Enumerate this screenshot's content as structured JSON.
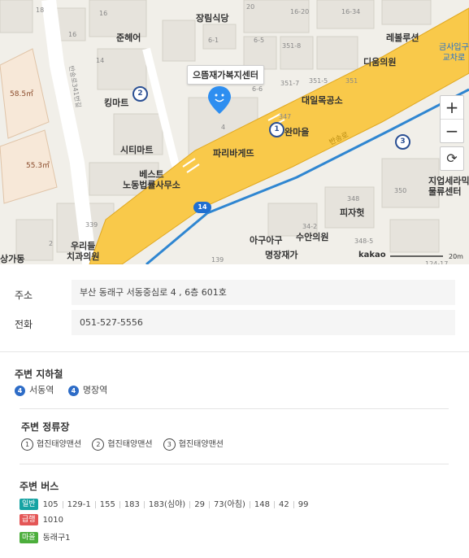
{
  "map": {
    "marker_label": "으뜸재가복지센터",
    "labels": {
      "jangrim": "장림식당",
      "junheo": "준헤어",
      "kingmart": "킹마트",
      "citymart": "시티마트",
      "best_law": "베스트\n노동법률사무소",
      "paris": "파리바게뜨",
      "daeil": "대일목공소",
      "maeul": "완마을",
      "rebeul": "레볼루션",
      "dium": "디움의원",
      "geumsa": "금사입구\n교차로",
      "jiup": "지업세라믹\n물류센터",
      "pizza": "피자헛",
      "agu": "아구아구",
      "suan": "수안의원",
      "myeongjang": "명장재가",
      "urideul": "우리들\n치과의원",
      "sang": "상가동",
      "road_name": "반송로",
      "side_road": "반송로341번길",
      "kakao": "kakao",
      "scale": "20m"
    },
    "numbers": [
      "18",
      "16",
      "20",
      "16-20",
      "16-34",
      "16",
      "6-1",
      "6-5",
      "351-8",
      "14",
      "351-7",
      "351-5",
      "351",
      "6-6",
      "4",
      "347",
      "350",
      "348",
      "339",
      "2",
      "34-2",
      "348-5",
      "139",
      "124-17"
    ],
    "areas": [
      "58.5㎡",
      "55.3㎡"
    ],
    "route_badge": "14",
    "stops": [
      "1",
      "2",
      "3"
    ],
    "controls": {
      "zoom_in": "+",
      "zoom_out": "−",
      "reset": "⟳"
    }
  },
  "address": {
    "label": "주소",
    "value": "부산 동래구 서동중심로 4 , 6층 601호"
  },
  "phone": {
    "label": "전화",
    "value": "051-527-5556"
  },
  "subway": {
    "title": "주변 지하철",
    "stations": [
      {
        "line": "4",
        "name": "서동역"
      },
      {
        "line": "4",
        "name": "명장역"
      }
    ]
  },
  "bus_stops": {
    "title": "주변 정류장",
    "items": [
      {
        "num": "1",
        "name": "협진태양맨션"
      },
      {
        "num": "2",
        "name": "협진태양맨션"
      },
      {
        "num": "3",
        "name": "협진태양맨션"
      }
    ]
  },
  "buses": {
    "title": "주변 버스",
    "groups": [
      {
        "tag": "일반",
        "color": "#16a3a3",
        "numbers": [
          "105",
          "129-1",
          "155",
          "183",
          "183(심야)",
          "29",
          "73(아침)",
          "148",
          "42",
          "99"
        ]
      },
      {
        "tag": "급행",
        "color": "#e45757",
        "numbers": [
          "1010"
        ]
      },
      {
        "tag": "마을",
        "color": "#4cae3c",
        "numbers": [
          "동래구1"
        ]
      }
    ]
  }
}
